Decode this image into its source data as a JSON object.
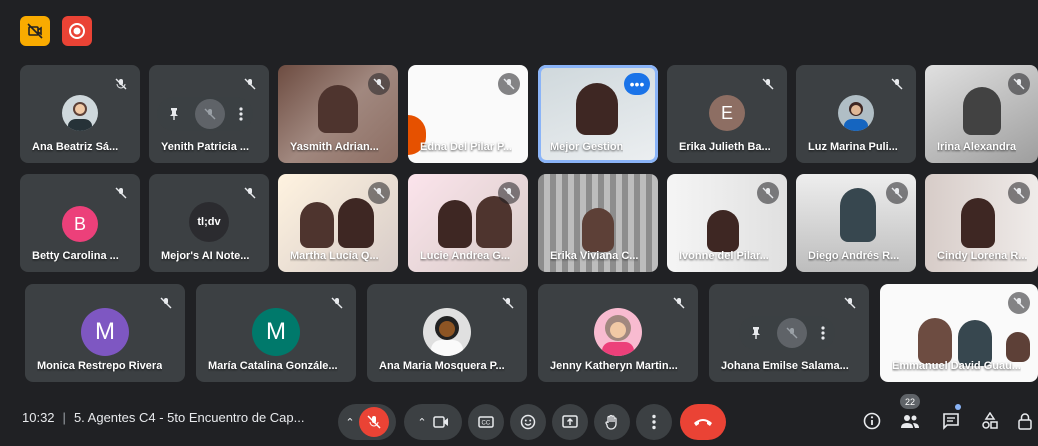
{
  "top_indicators": {
    "left_icon": "no-camera-icon",
    "right_icon": "record-icon"
  },
  "participants_row1": [
    {
      "name": "Ana Beatriz Sá...",
      "type": "photo-avatar"
    },
    {
      "name": "Yenith Patricia ...",
      "type": "hover"
    },
    {
      "name": "Yasmith Adrian...",
      "type": "video"
    },
    {
      "name": "Edna Del Pilar P...",
      "type": "video"
    },
    {
      "name": "Mejor Gestion",
      "type": "video-active"
    },
    {
      "name": "Erika Julieth Ba...",
      "type": "letter",
      "letter": "E",
      "color": "#8d6e63"
    },
    {
      "name": "Luz Marina Puli...",
      "type": "photo-avatar"
    },
    {
      "name": "Irina Alexandra",
      "type": "video"
    }
  ],
  "participants_row2": [
    {
      "name": "Betty Carolina ...",
      "type": "letter",
      "letter": "B",
      "color": "#ec407a"
    },
    {
      "name": "Mejor's AI Note...",
      "type": "logo",
      "logo_text": "tl;dv"
    },
    {
      "name": "Martha Lucía Q...",
      "type": "video"
    },
    {
      "name": "Lucie Andrea G...",
      "type": "video"
    },
    {
      "name": "Erika Viviana C...",
      "type": "video"
    },
    {
      "name": "Ivonne del Pilar...",
      "type": "video"
    },
    {
      "name": "Diego Andrés R...",
      "type": "video"
    },
    {
      "name": "Cindy Lorena R...",
      "type": "video"
    }
  ],
  "participants_row3": [
    {
      "name": "Monica Restrepo Rivera",
      "type": "letter",
      "letter": "M",
      "color": "#7e57c2"
    },
    {
      "name": "María Catalina Gonzále...",
      "type": "letter",
      "letter": "M",
      "color": "#00796b"
    },
    {
      "name": "Ana Maria Mosquera P...",
      "type": "photo-avatar"
    },
    {
      "name": "Jenny Katheryn Martin...",
      "type": "photo-avatar"
    },
    {
      "name": "Johana Emilse Salama...",
      "type": "hover"
    },
    {
      "name": "Emmanuel David Guau...",
      "type": "video"
    }
  ],
  "bottom_bar": {
    "time": "10:32",
    "meeting_title": "5. Agentes C4 - 5to Encuentro de Cap...",
    "participant_count": "22"
  },
  "colors": {
    "background": "#202124",
    "tile": "#3c4043",
    "end_call": "#ea4335",
    "active_border": "#8ab4f8"
  }
}
